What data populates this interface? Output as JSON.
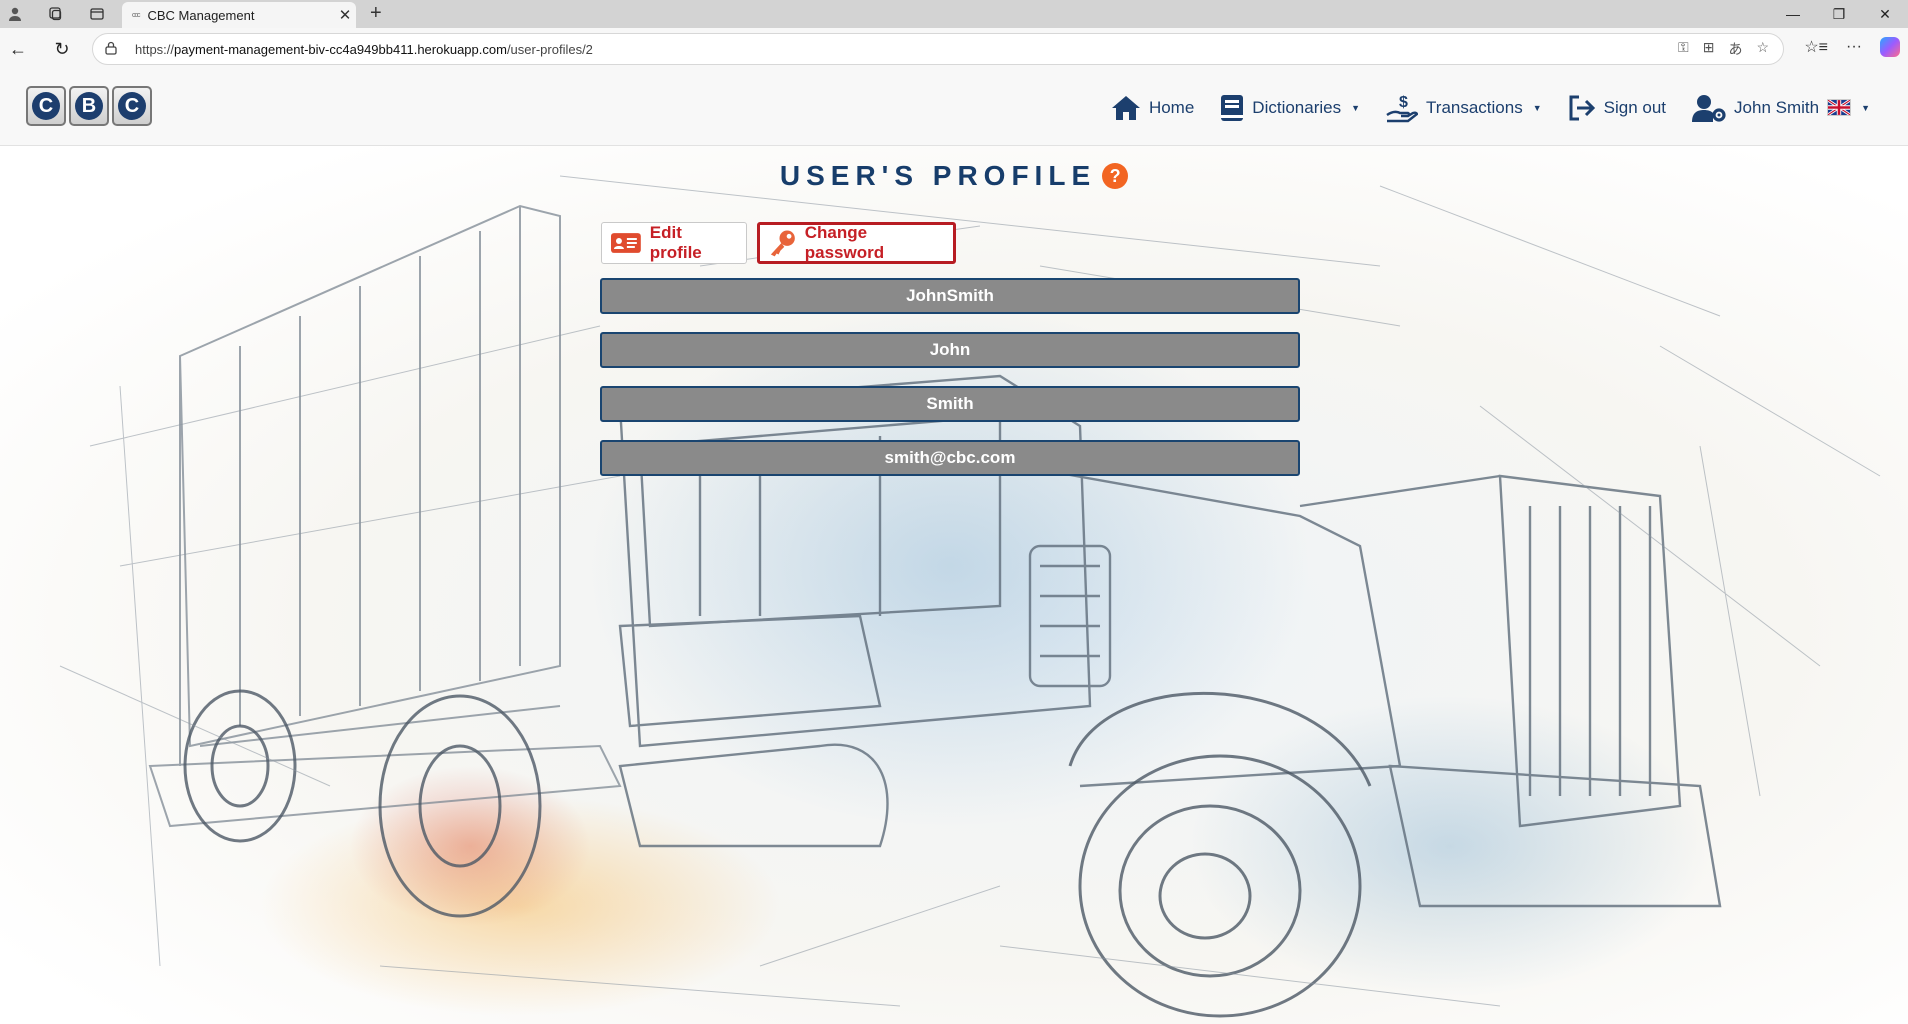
{
  "browser": {
    "tab_title": "CBC Management",
    "tab_favicon": "ccc",
    "url_prefix": "https://",
    "url_host": "payment-management-biv-cc4a949bb411.herokuapp.com",
    "url_path": "/user-profiles/2"
  },
  "header": {
    "logo_letters": [
      "C",
      "B",
      "C"
    ],
    "nav": {
      "home": "Home",
      "dictionaries": "Dictionaries",
      "transactions": "Transactions",
      "sign_out": "Sign out",
      "user": "John Smith"
    },
    "language_flag": "uk-flag"
  },
  "page": {
    "title": "USER'S PROFILE",
    "help_label": "?",
    "edit_profile": "Edit profile",
    "change_password": "Change password",
    "fields": {
      "username": "JohnSmith",
      "first_name": "John",
      "last_name": "Smith",
      "email": "smith@cbc.com"
    }
  },
  "colors": {
    "brand_navy": "#173d6b",
    "accent_red": "#c62026",
    "help_orange": "#f26522",
    "field_gray": "#8a8a8a"
  }
}
